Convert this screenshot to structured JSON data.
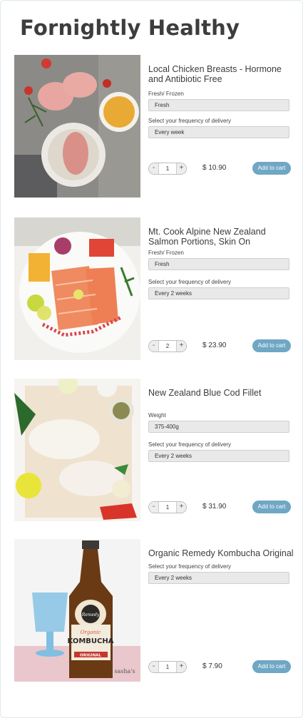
{
  "page": {
    "title": "Fornightly Healthy"
  },
  "products": [
    {
      "name": "Local Chicken Breasts - Hormone and Antibiotic Free",
      "fields": [
        {
          "label": "Fresh/ Frozen",
          "value": "Fresh"
        },
        {
          "label": "Select your frequency of delivery",
          "value": "Every week"
        }
      ],
      "quantity": "1",
      "price": "$ 10.90",
      "add_label": "Add to cart"
    },
    {
      "name": "Mt. Cook Alpine New Zealand Salmon Portions, Skin On",
      "fields": [
        {
          "label": "Fresh/ Frozen",
          "value": "Fresh"
        },
        {
          "label": "Select your frequency of delivery",
          "value": "Every 2 weeks"
        }
      ],
      "quantity": "2",
      "price": "$ 23.90",
      "add_label": "Add to cart"
    },
    {
      "name": "New Zealand Blue Cod Fillet",
      "fields": [
        {
          "label": "Weight",
          "value": "375-400g"
        },
        {
          "label": "Select your frequency of delivery",
          "value": "Every 2 weeks"
        }
      ],
      "quantity": "1",
      "price": "$ 31.90",
      "add_label": "Add to cart"
    },
    {
      "name": "Organic Remedy Kombucha Original",
      "fields": [
        {
          "label": "Select your frequency of delivery",
          "value": "Every 2 weeks"
        }
      ],
      "quantity": "1",
      "price": "$ 7.90",
      "add_label": "Add to cart"
    }
  ],
  "image_text": {
    "kombucha_brand": "Remedy",
    "kombucha_label_top": "Organic",
    "kombucha_label_main": "KOMBUCHA",
    "kombucha_label_bottom": "ORIGINAL",
    "photo_watermark": "sasha's"
  },
  "stepper": {
    "minus": "-",
    "plus": "+"
  },
  "colors": {
    "accent": "#6fa7c5",
    "field_bg": "#e9e9e9",
    "title": "#3d3d3d"
  }
}
